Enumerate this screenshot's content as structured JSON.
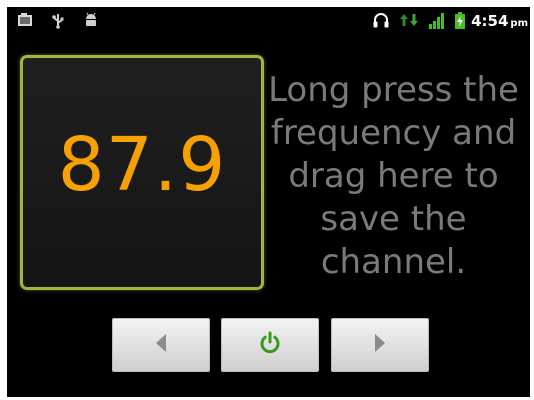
{
  "status_bar": {
    "left_icons": [
      "gallery-icon",
      "usb-icon",
      "android-debug-icon"
    ],
    "right_icons": [
      "headset-icon",
      "data-transfer-icon",
      "signal-icon",
      "battery-charging-icon"
    ],
    "time": "4:54",
    "ampm": "pm"
  },
  "radio": {
    "frequency": "87.9",
    "hint": "Long press the frequency and drag here to save the channel."
  },
  "controls": {
    "prev_icon": "prev-icon",
    "power_icon": "power-icon",
    "next_icon": "next-icon"
  },
  "colors": {
    "frequency": "#f7a100",
    "panel_border": "#a6b43d",
    "hint_text": "#7a7a7a",
    "power_icon": "#3a9a1e"
  }
}
